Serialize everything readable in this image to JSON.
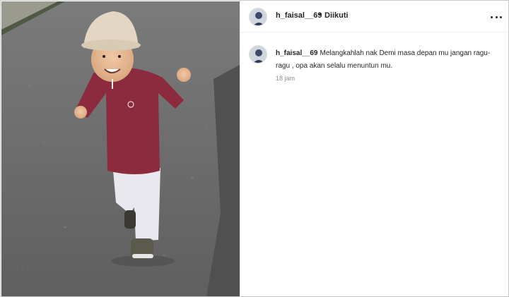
{
  "post": {
    "username": "h_faisal__69",
    "separator": "•",
    "follow_status": "Diikuti",
    "more_icon": "more-horizontal-icon",
    "caption": {
      "username": "h_faisal__69",
      "text": "Melangkahlah nak Demi masa depan mu jangan ragu-ragu , opa akan selalu menuntun mu."
    },
    "timestamp": "18 jam"
  }
}
